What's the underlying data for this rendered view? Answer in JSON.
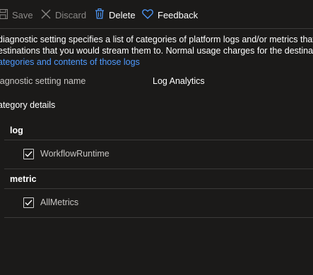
{
  "toolbar": {
    "save_label": "Save",
    "discard_label": "Discard",
    "delete_label": "Delete",
    "feedback_label": "Feedback"
  },
  "description": {
    "line1": "diagnostic setting specifies a list of categories of platform logs and/or metrics that yo",
    "line2": "estinations that you would stream them to. Normal usage charges for the destination w",
    "link": "ategories and contents of those logs"
  },
  "setting": {
    "name_label": "iagnostic setting name",
    "name_value": "Log Analytics"
  },
  "category_details": {
    "heading": "ategory details",
    "groups": [
      {
        "label": "log",
        "items": [
          {
            "label": "WorkflowRuntime",
            "checked": true
          }
        ]
      },
      {
        "label": "metric",
        "items": [
          {
            "label": "AllMetrics",
            "checked": true
          }
        ]
      }
    ]
  },
  "colors": {
    "background": "#1b1a19",
    "link": "#4f9bff",
    "divider": "#3b3a39",
    "disabled_text": "#8a8886"
  }
}
